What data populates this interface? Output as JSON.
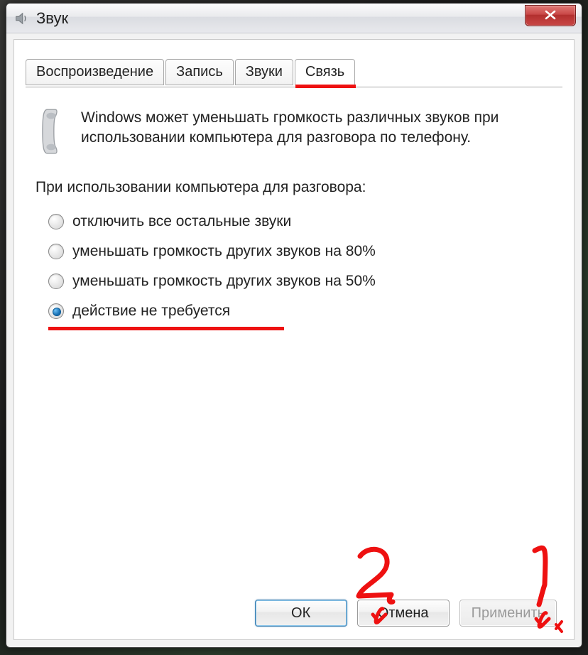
{
  "window": {
    "title": "Звук"
  },
  "tabs": [
    {
      "label": "Воспроизведение",
      "active": false
    },
    {
      "label": "Запись",
      "active": false
    },
    {
      "label": "Звуки",
      "active": false
    },
    {
      "label": "Связь",
      "active": true
    }
  ],
  "description": "Windows может уменьшать громкость различных звуков при использовании компьютера для разговора по телефону.",
  "subheading": "При использовании компьютера для разговора:",
  "options": [
    {
      "label": "отключить все остальные звуки",
      "checked": false
    },
    {
      "label": "уменьшать громкость других звуков на 80%",
      "checked": false
    },
    {
      "label": "уменьшать громкость других звуков на 50%",
      "checked": false
    },
    {
      "label": "действие не требуется",
      "checked": true
    }
  ],
  "buttons": {
    "ok": "ОК",
    "cancel": "Отмена",
    "apply": "Применить"
  },
  "annotations": {
    "mark1": "1",
    "mark2": "2"
  }
}
